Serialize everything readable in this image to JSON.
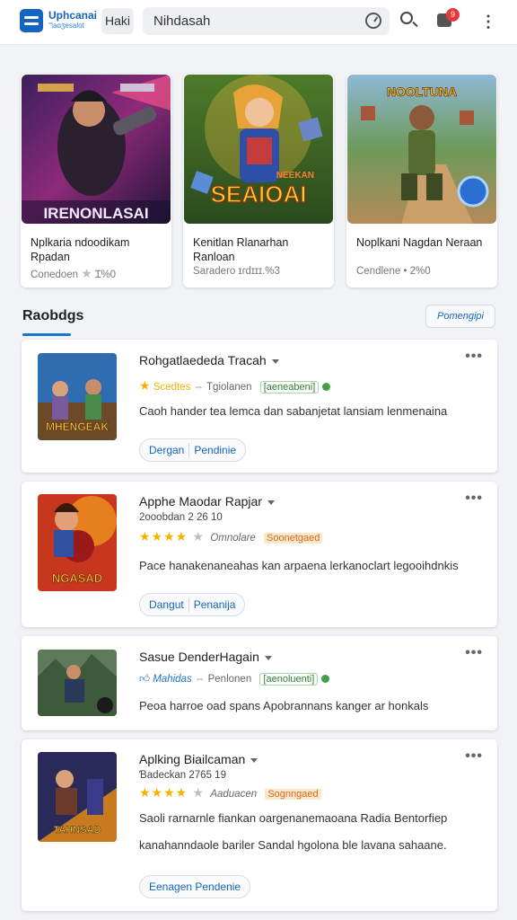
{
  "header": {
    "brand_line1": "Uphcanai",
    "brand_line2": "ℸaɑʒesalot",
    "chip_label": "Haki",
    "search_value": "Nihdasah",
    "notification_count": "9"
  },
  "featured": [
    {
      "art_title": "IRENONLASAI",
      "title": "Nplkaria ndoodikam Rpadan",
      "meta_left": "Conedoen",
      "meta_right": "Ɪ%0"
    },
    {
      "art_title": "SEAIOAI",
      "art_subtitle": "NEEKAN",
      "title": "Kenitlan Rlanarhan Ranloan",
      "meta_left": "Saradero",
      "meta_right": "ɪɾdɪɪɪ.%3"
    },
    {
      "art_title": "NOOLTUNA",
      "title": "Noplkani Nagdan Neraan",
      "meta_left": "Cendlene",
      "meta_right": "2%0"
    }
  ],
  "section": {
    "title": "Raobdgs",
    "button_label": "Pomengipi"
  },
  "apps": [
    {
      "title": "Rohgatlaededa Tracah",
      "meta": {
        "rating_text": "Scedtes",
        "dev": "Tgiolanen",
        "tag": "[aeneabeni]"
      },
      "desc": "Caoh hander tea lemca dan sabanjetat lansiam lenmenaina",
      "btn1": "Dergan",
      "btn2": "Pendinie",
      "thumb_text": "MHENGEAK"
    },
    {
      "title": "Apphe Maodar Rapjar",
      "sub": "2ooobdan 2 26 10",
      "meta": {
        "stars": 4,
        "dev": "Omnolare",
        "tag": "Soonetgaed"
      },
      "desc": "Pace hanakenaneahas kan arpaena lerkanoclart legooihdnkis",
      "btn1": "Dangut",
      "btn2": "Penanija",
      "thumb_text": "NGASAD"
    },
    {
      "title": "Sasue DenderHagain",
      "meta": {
        "rating_text": "Mahidas",
        "dev": "Penlonen",
        "tag": "[aenoluenti]"
      },
      "desc": "Peoa harroe oad spans Apobrannans kanger ar honkals"
    },
    {
      "title": "Aplking Biailcaman",
      "sub": "Ɓadeckan 2765 19",
      "meta": {
        "stars": 4,
        "dev": "Aaduacen",
        "tag": "Sognngaed"
      },
      "desc": "Saoli rarnarnle fiankan oargenanemaoana Radia Bentorfiep kanahanndaole bariler Sandal hgolona ble lavana sahaane.",
      "btn1": "Eenagen Pendenie",
      "thumb_text": "TAHNSAD"
    }
  ],
  "colors": {
    "accent": "#1976d2",
    "star": "#f4b400",
    "badge": "#e53935"
  }
}
